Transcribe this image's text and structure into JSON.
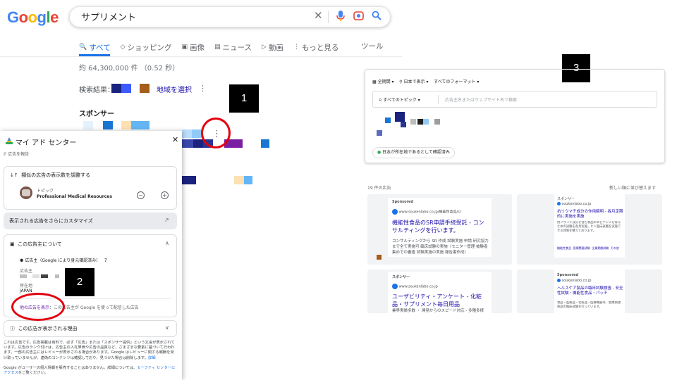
{
  "google": {
    "logo_letters": [
      {
        "ch": "G",
        "color": "#4285f4"
      },
      {
        "ch": "o",
        "color": "#ea4335"
      },
      {
        "ch": "o",
        "color": "#fbbc05"
      },
      {
        "ch": "g",
        "color": "#4285f4"
      },
      {
        "ch": "l",
        "color": "#34a853"
      },
      {
        "ch": "e",
        "color": "#ea4335"
      }
    ],
    "query": "サプリメント",
    "tabs": [
      {
        "icon": "magnifier-icon",
        "glyph": "🔍",
        "label": "すべて",
        "active": true
      },
      {
        "icon": "tag-icon",
        "glyph": "◇",
        "label": "ショッピング",
        "active": false
      },
      {
        "icon": "image-icon",
        "glyph": "▣",
        "label": "画像",
        "active": false
      },
      {
        "icon": "news-icon",
        "glyph": "▤",
        "label": "ニュース",
        "active": false
      },
      {
        "icon": "video-icon",
        "glyph": "▷",
        "label": "動画",
        "active": false
      },
      {
        "icon": "more-vert-icon",
        "glyph": "⋮",
        "label": "もっと見る",
        "active": false
      }
    ],
    "tools": "ツール",
    "stats": "約 64,300,000 件 （0.52 秒）",
    "filter_label": "検索結果：",
    "region_link": "地域を選択",
    "sponsored": "スポンサー"
  },
  "annotations": {
    "one": "1",
    "two": "2",
    "three": "3"
  },
  "panel": {
    "title": "マイ アド センター",
    "back": "広告を報告",
    "adjust_title": "類似の広告の表示数を調整する",
    "topic_label": "トピック",
    "topic_name": "Professional Medical Resources",
    "customize": "表示される広告をさらにカスタマイズ",
    "advertiser_section": "この広告主について",
    "advertiser_verified": "広告主（Google により身元確認済み）",
    "advertiser_label": "広告主",
    "location_label": "所在地",
    "location_value": "JAPAN",
    "other_ads_link": "他の広告を表示",
    "other_ads_rest": "この広告主が Google を使って配信した広告",
    "why_section": "この広告が表示される理由",
    "disclaimer1": "これは広告です。広告掲載は有料で、必ず「広告」または「スポンサー提供」という文言が表示されています。広告のランク付けは、広告主の入札単価や広告の品質など、さまざまな要素に基づいて行われます。一部の広告主にはレビューが表示される場合があります。Google はレビューに関する報酬を受け取っていませんが、虚偽のコンテンツは確認しており、見つけた場合は削除します。",
    "disclaimer1_link": "詳細",
    "disclaimer2": "Google がユーザーの個人情報を販売することはありません。詳細については、",
    "disclaimer2_link": "セーフティ センターにアクセス",
    "disclaimer2_end": "をご覧ください。"
  },
  "transparency": {
    "filter_period": "全期間",
    "filter_region": "日本で表示",
    "filter_format": "すべてのフォーマット",
    "topic_dropdown": "すべてのトピック",
    "search_placeholder": "広告主名またはウェブサイト名で検索",
    "verified_badge": "日本が所在地であるとして確認済み",
    "ad_count": "19 件の広告",
    "sort": "新しい順に並び替えます",
    "ads": [
      {
        "label": "Sponsored",
        "url": "www.soukenlabo.co.jp/機能性食品/sr",
        "title": "機能性食品のSR申請手続受託 - コンサルティングを行います。",
        "desc": "コンサルティングから SR 作成 試験実施 申請 研究協力まで全て実施可 臨床試験の実施（モニター管理 被験者集めでの審査 試験実施の実施 報告書作成）"
      },
      {
        "label": "スポンサー",
        "url": "soukenlabo.co.jp",
        "title": "抗リウマチ成分の作用解明 - 各月定期的に実施を実施",
        "desc": "抗リウマチ成分を含む食品のエビデンスを得るための試験を各月実施。ヒト臨床試験を実施できる体制を整えております。",
        "links": [
          "機能性食品",
          "医療関連試験",
          "企業実績試験",
          "その他"
        ]
      },
      {
        "label": "スポンサー",
        "url": "www.soukenlabo.co.jp",
        "title": "ユーザビリティ・アンケート - 化粧品・サプリメント毎日用品",
        "desc": "業界実績多数 ・ 開発からのスピード対応・多種多様"
      },
      {
        "label": "Sponsored",
        "url": "soukenlabo.co.jp",
        "title": "ヘルスケア製品の臨床試験検査 - 安全性試験・機能性食品・パッチ",
        "desc": "食品・医薬品・化粧品・医療機器等、健康関連商品の臨床試験を行っています。"
      }
    ]
  },
  "colors": {
    "google_blue": "#1a73e8",
    "link_blue": "#1a0dab",
    "annotation_red": "#e3000f",
    "pixel_colors": [
      "#1a237e",
      "#3949ab",
      "#1565c0",
      "#90caf9",
      "#283593",
      "#6a1b9a",
      "#c0c0c0",
      "#ffe0b2",
      "#a65c1a"
    ]
  }
}
